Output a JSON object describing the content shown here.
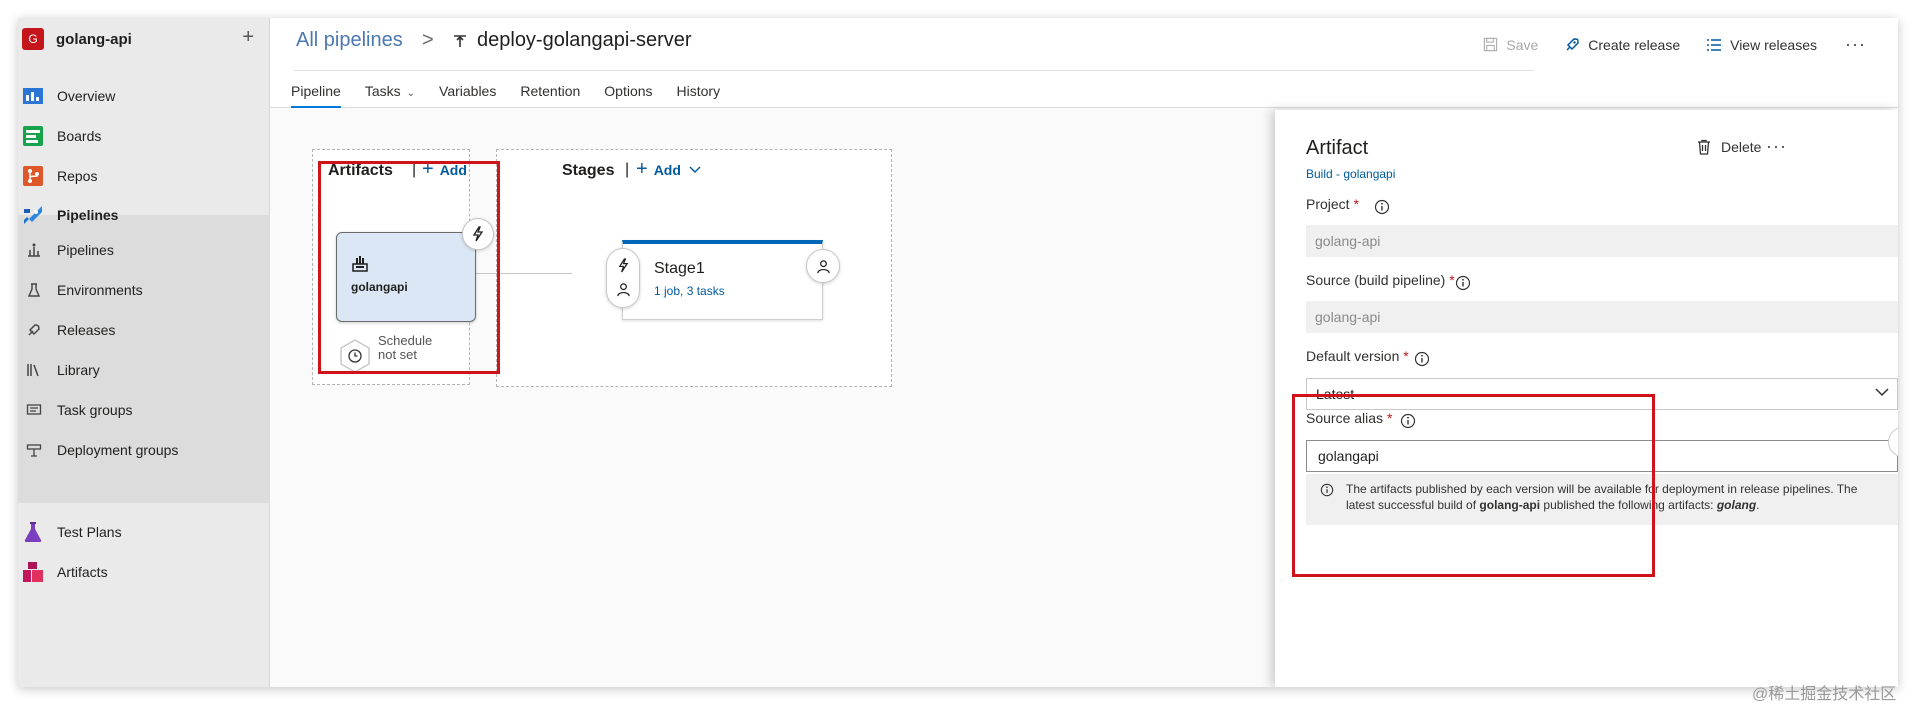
{
  "project": {
    "avatar": "G",
    "name": "golang-api",
    "add_icon": "plus-icon"
  },
  "sidebar": {
    "items": [
      {
        "label": "Overview",
        "icon": "overview-icon"
      },
      {
        "label": "Boards",
        "icon": "boards-icon"
      },
      {
        "label": "Repos",
        "icon": "repos-icon"
      },
      {
        "label": "Pipelines",
        "icon": "pipelines-icon",
        "selected": true
      },
      {
        "label": "Pipelines",
        "icon": "pipelines-sub-icon"
      },
      {
        "label": "Environments",
        "icon": "environments-icon"
      },
      {
        "label": "Releases",
        "icon": "releases-icon"
      },
      {
        "label": "Library",
        "icon": "library-icon"
      },
      {
        "label": "Task groups",
        "icon": "task-groups-icon"
      },
      {
        "label": "Deployment groups",
        "icon": "deployment-groups-icon"
      },
      {
        "label": "Test Plans",
        "icon": "test-plans-icon"
      },
      {
        "label": "Artifacts",
        "icon": "artifacts-icon"
      }
    ]
  },
  "header": {
    "breadcrumb_root": "All pipelines",
    "breadcrumb_sep": ">",
    "title": "deploy-golangapi-server",
    "tabs": [
      "Pipeline",
      "Tasks",
      "Variables",
      "Retention",
      "Options",
      "History"
    ],
    "active_tab": "Pipeline",
    "actions": {
      "save": "Save",
      "create_release": "Create release",
      "view_releases": "View releases",
      "more": "···"
    }
  },
  "canvas": {
    "artifacts_title": "Artifacts",
    "stages_title": "Stages",
    "separator": "|",
    "add_label": "Add",
    "artifact_card_name": "golangapi",
    "schedule_line1": "Schedule",
    "schedule_line2": "not set",
    "stage": {
      "name": "Stage1",
      "jobs": "1 job",
      "sep": ", ",
      "tasks": "3 tasks"
    }
  },
  "panel": {
    "title": "Artifact",
    "subtitle": "Build - golangapi",
    "delete_label": "Delete",
    "more": "···",
    "project_label": "Project",
    "project_value": "golang-api",
    "source_label": "Source (build pipeline)",
    "source_value": "golang-api",
    "default_version_label": "Default version",
    "default_version_value": "Latest",
    "alias_label": "Source alias",
    "alias_value": "golangapi",
    "required_mark": "*",
    "info_prefix": "The artifacts published by each version will be available for deployment in release pipelines. The latest successful build of ",
    "info_project": "golang-api",
    "info_middle": "  published the following artifacts: ",
    "info_artifact": "golang",
    "info_suffix": "."
  },
  "watermark": "@稀土掘金技术社区",
  "colors": {
    "accent": "#0078d4",
    "link": "#005a9e",
    "highlight_box": "#d0121b",
    "project_avatar": "#c4151c"
  }
}
